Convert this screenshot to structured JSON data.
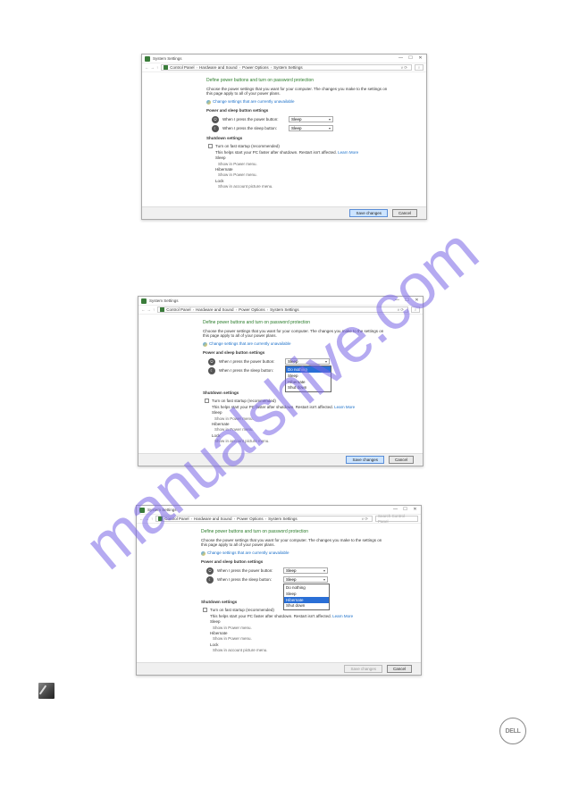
{
  "watermark": "manualshive.com",
  "dell": "DELL",
  "windows": {
    "w1": {
      "title": "System Settings",
      "breadcrumb": [
        "Control Panel",
        "Hardware and Sound",
        "Power Options",
        "System Settings"
      ],
      "addr_end": "v   ⟳",
      "search_placeholder": "⌕",
      "heading": "Define power buttons and turn on password protection",
      "desc": "Choose the power settings that you want for your computer. The changes you make to the settings on this page apply to all of your power plans.",
      "change_link": "Change settings that are currently unavailable",
      "section1": "Power and sleep button settings",
      "row_power_label": "When I press the power button:",
      "row_power_value": "Sleep",
      "row_sleep_label": "When I press the sleep button:",
      "row_sleep_value": "Sleep",
      "section2": "Shutdown settings",
      "fast_label": "Turn on fast startup (recommended)",
      "fast_help": "This helps start your PC faster after shutdown. Restart isn't affected.",
      "learn_more": "Learn More",
      "opts": [
        {
          "t": "Sleep",
          "s": "Show in Power menu."
        },
        {
          "t": "Hibernate",
          "s": "Show in Power menu."
        },
        {
          "t": "Lock",
          "s": "Show in account picture menu."
        }
      ],
      "btn_save": "Save changes",
      "btn_cancel": "Cancel"
    },
    "w2": {
      "title": "System Settings",
      "breadcrumb": [
        "Control Panel",
        "Hardware and Sound",
        "Power Options",
        "System Settings"
      ],
      "addr_end": "v   ⟳",
      "search_placeholder": "⌕",
      "heading": "Define power buttons and turn on password protection",
      "desc": "Choose the power settings that you want for your computer. The changes you make to the settings on this page apply to all of your power plans.",
      "change_link": "Change settings that are currently unavailable",
      "section1": "Power and sleep button settings",
      "row_power_label": "When I press the power button:",
      "row_power_value": "Sleep",
      "dd_options": [
        "Do nothing",
        "Sleep",
        "Hibernate",
        "Shut down"
      ],
      "dd_selected": "Do nothing",
      "row_sleep_label": "When I press the sleep button:",
      "section2": "Shutdown settings",
      "fast_label": "Turn on fast startup (recommended)",
      "fast_help": "This helps start your PC faster after shutdown. Restart isn't affected.",
      "learn_more": "Learn More",
      "opts": [
        {
          "t": "Sleep",
          "s": "Show in Power menu."
        },
        {
          "t": "Hibernate",
          "s": "Show in Power menu."
        },
        {
          "t": "Lock",
          "s": "Show in account picture menu."
        }
      ],
      "btn_save": "Save changes",
      "btn_cancel": "Cancel"
    },
    "w3": {
      "title": "System Settings",
      "breadcrumb": [
        "Control Panel",
        "Hardware and Sound",
        "Power Options",
        "System Settings"
      ],
      "addr_end": "v   ⟳",
      "search_placeholder": "Search Control Panel",
      "heading": "Define power buttons and turn on password protection",
      "desc": "Choose the power settings that you want for your computer. The changes you make to the settings on this page apply to all of your power plans.",
      "change_link": "Change settings that are currently unavailable",
      "section1": "Power and sleep button settings",
      "row_power_label": "When I press the power button:",
      "row_power_value": "Sleep",
      "row_sleep_label": "When I press the sleep button:",
      "row_sleep_value": "Sleep",
      "dd_options": [
        "Do nothing",
        "Sleep",
        "Hibernate",
        "Shut down"
      ],
      "dd_selected": "Hibernate",
      "section2": "Shutdown settings",
      "fast_label": "Turn on fast startup (recommended)",
      "fast_help": "This helps start your PC faster after shutdown. Restart isn't affected.",
      "learn_more": "Learn More",
      "opts": [
        {
          "t": "Sleep",
          "s": "Show in Power menu."
        },
        {
          "t": "Hibernate",
          "s": "Show in Power menu."
        },
        {
          "t": "Lock",
          "s": "Show in account picture menu."
        }
      ],
      "btn_save": "Save changes",
      "btn_cancel": "Cancel"
    }
  }
}
